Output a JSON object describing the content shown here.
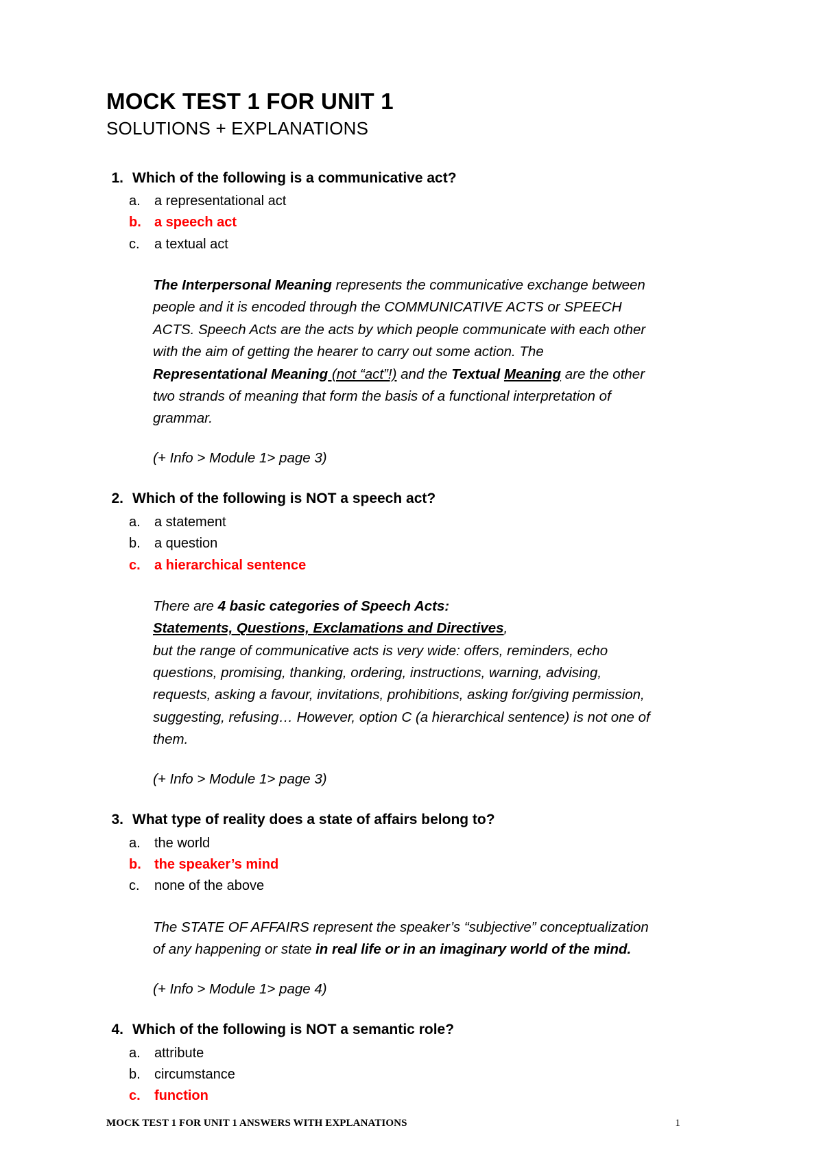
{
  "document": {
    "title": "MOCK TEST 1 FOR UNIT 1",
    "subtitle": "SOLUTIONS + EXPLANATIONS"
  },
  "questions": [
    {
      "number": "1.",
      "text": "Which of the following is a communicative act?",
      "options": [
        {
          "letter": "a.",
          "text": "a representational act",
          "correct": false
        },
        {
          "letter": "b.",
          "text": "a speech act",
          "correct": true
        },
        {
          "letter": "c.",
          "text": "a textual act",
          "correct": false
        }
      ],
      "explanation_plain": "The Interpersonal Meaning represents the communicative exchange between people and it is encoded through the COMMUNICATIVE ACTS or SPEECH ACTS. Speech Acts are the acts by which people communicate with each other with the aim of getting the hearer to carry out some action. The Representational Meaning (not “act”!) and the Textual Meaning are the other two strands of meaning that form the basis of a functional interpretation of grammar.",
      "explanation_html": "<b>The Interpersonal Meaning</b> represents the communicative exchange between people and it is encoded through the COMMUNICATIVE ACTS or SPEECH ACTS. Speech Acts are the acts by which people communicate with each other with the aim of getting the hearer to carry out some action. The <b>Representational Meaning</b><u> (not “act”!)</u> and the <b>Textual </b><span class=\"bu\">Meaning</span> are the other two strands of meaning that form the basis of a functional interpretation of grammar.",
      "reference": "(+ Info > Module 1> page 3)"
    },
    {
      "number": "2.",
      "text": "Which of the following is NOT a speech act?",
      "options": [
        {
          "letter": "a.",
          "text": "a statement",
          "correct": false
        },
        {
          "letter": "b.",
          "text": "a question",
          "correct": false
        },
        {
          "letter": "c.",
          "text": "a hierarchical sentence",
          "correct": true
        }
      ],
      "explanation_plain": "There are 4 basic categories of Speech Acts: Statements, Questions, Exclamations and Directives, but the range of communicative acts is very wide: offers, reminders, echo questions, promising, thanking, ordering, instructions, warning, advising, requests, asking a favour, invitations, prohibitions, asking for/giving permission, suggesting, refusing… However, option C (a hierarchical sentence) is not one of them.",
      "explanation_html": "There are <b>4 basic categories of Speech Acts:</b><br><span class=\"bu\">Statements, Questions, Exclamations and Directives</span>,<br>but the range of communicative acts is very wide: offers, reminders, echo questions, promising, thanking, ordering, instructions, warning, advising, requests, asking a favour, invitations, prohibitions, asking for/giving permission, suggesting, refusing… However, option C (a hierarchical sentence) is not one of them.",
      "reference": "(+ Info > Module 1> page 3)"
    },
    {
      "number": "3.",
      "text": "What type of reality does a state of affairs belong to?",
      "options": [
        {
          "letter": "a.",
          "text": "the world",
          "correct": false
        },
        {
          "letter": "b.",
          "text": "the speaker’s mind",
          "correct": true
        },
        {
          "letter": "c.",
          "text": "none of the above",
          "correct": false
        }
      ],
      "explanation_plain": "The STATE OF AFFAIRS represent the speaker’s “subjective” conceptualization of any happening or state in real life or in an imaginary world of the mind.",
      "explanation_html": "The STATE OF AFFAIRS represent the speaker’s “subjective” conceptualization of any happening or state <b>in real life or in an imaginary world of the mind.</b>",
      "reference": "(+ Info > Module 1> page 4)"
    },
    {
      "number": "4.",
      "text": "Which of the following is NOT a semantic role?",
      "options": [
        {
          "letter": "a.",
          "text": "attribute",
          "correct": false
        },
        {
          "letter": "b.",
          "text": "circumstance",
          "correct": false
        },
        {
          "letter": "c.",
          "text": "function",
          "correct": true
        }
      ],
      "explanation_plain": "",
      "explanation_html": "",
      "reference": ""
    }
  ],
  "footer": {
    "text": "MOCK TEST 1 FOR UNIT 1 ANSWERS WITH EXPLANATIONS",
    "page_number": "1"
  },
  "colors": {
    "correct_answer": "#ff0000",
    "body_text": "#000000",
    "page_background": "#ffffff"
  }
}
